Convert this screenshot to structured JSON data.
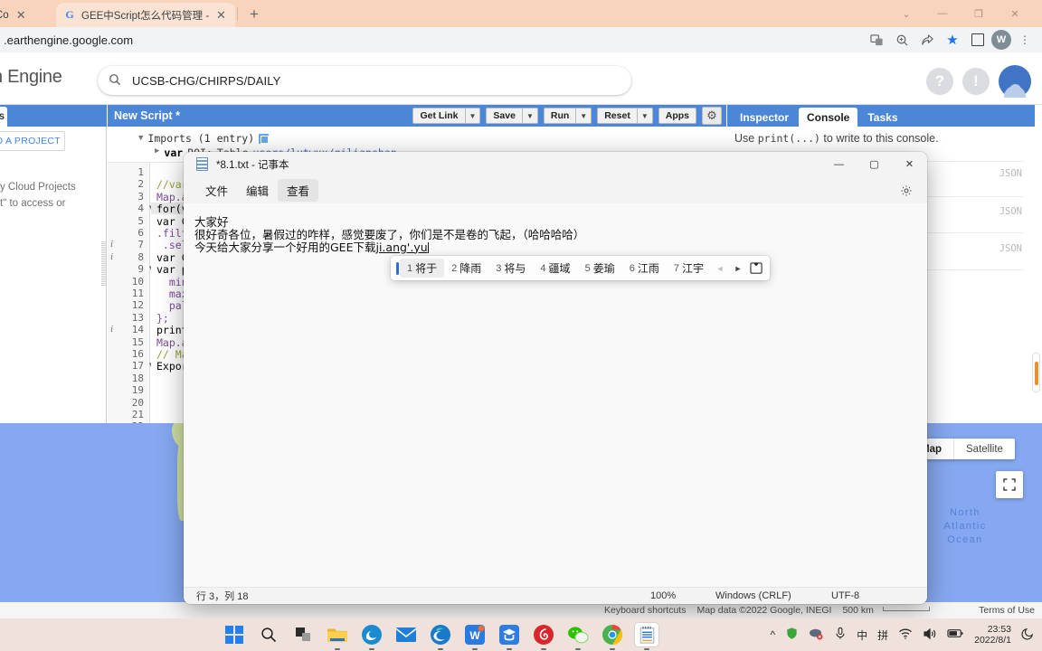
{
  "browser": {
    "tabs": [
      {
        "title": "gine Co",
        "favicon": "none",
        "active": false
      },
      {
        "title": "GEE中Script怎么代码管理 - Goo",
        "favicon": "google-g",
        "active": true
      }
    ],
    "new_tab_label": "+",
    "window_controls": [
      "chevron-down",
      "minimize",
      "maximize",
      "close"
    ],
    "address": ".earthengine.google.com",
    "toolbar_icons": [
      "translate-icon",
      "zoom-icon",
      "share-icon",
      "bookmark-star-icon",
      "sidepanel-icon",
      "profile-avatar",
      "menu-dots-icon"
    ],
    "profile_initial": "W"
  },
  "gee": {
    "logo": "h Engine",
    "search": {
      "value": "UCSB-CHG/CHIRPS/DAILY",
      "icon": "search-icon"
    },
    "help_icon": "help-icon",
    "notification_icon": "alert-icon"
  },
  "left_panel": {
    "tab_label": "ts",
    "new_project_button": "O A PROJECT",
    "body_text_line1": "y Cloud Projects",
    "body_text_line2": "t\" to access or"
  },
  "editor": {
    "script_title": "New Script *",
    "buttons": [
      {
        "label": "Get Link",
        "has_dropdown": true
      },
      {
        "label": "Save",
        "has_dropdown": true
      },
      {
        "label": "Run",
        "has_dropdown": true
      },
      {
        "label": "Reset",
        "has_dropdown": true
      },
      {
        "label": "Apps",
        "has_dropdown": false
      }
    ],
    "settings_icon": "gear-icon",
    "imports": {
      "header": "Imports (1 entry)",
      "entry_keyword": "var",
      "entry_name": "ROI:",
      "entry_type": "Table",
      "entry_path": "users/lutwxx/qilianshan"
    },
    "lines": [
      {
        "n": 1,
        "fold": false,
        "info": false,
        "text": ""
      },
      {
        "n": 2,
        "fold": false,
        "info": false,
        "text": "//var"
      },
      {
        "n": 3,
        "fold": false,
        "info": false,
        "text": "Map.a"
      },
      {
        "n": 4,
        "fold": true,
        "info": false,
        "text": "for(v"
      },
      {
        "n": 5,
        "fold": false,
        "info": false,
        "text": "var C"
      },
      {
        "n": 6,
        "fold": false,
        "info": false,
        "text": ".filt"
      },
      {
        "n": 7,
        "fold": false,
        "info": true,
        "text": " .sel"
      },
      {
        "n": 8,
        "fold": false,
        "info": true,
        "text": "var C"
      },
      {
        "n": 9,
        "fold": true,
        "info": false,
        "text": "var p"
      },
      {
        "n": 10,
        "fold": false,
        "info": false,
        "text": "  min"
      },
      {
        "n": 11,
        "fold": false,
        "info": false,
        "text": "  max"
      },
      {
        "n": 12,
        "fold": false,
        "info": false,
        "text": "  pal"
      },
      {
        "n": 13,
        "fold": false,
        "info": false,
        "text": "};"
      },
      {
        "n": 14,
        "fold": false,
        "info": true,
        "text": "print"
      },
      {
        "n": 15,
        "fold": false,
        "info": false,
        "text": "Map.a"
      },
      {
        "n": 16,
        "fold": false,
        "info": false,
        "text": "// Ma"
      },
      {
        "n": 17,
        "fold": true,
        "info": false,
        "text": "Expor"
      },
      {
        "n": 18,
        "fold": false,
        "info": false,
        "text": ""
      },
      {
        "n": 19,
        "fold": false,
        "info": false,
        "text": ""
      },
      {
        "n": 20,
        "fold": false,
        "info": false,
        "text": ""
      },
      {
        "n": 21,
        "fold": false,
        "info": false,
        "text": ""
      },
      {
        "n": 22,
        "fold": false,
        "info": false,
        "text": ""
      }
    ]
  },
  "console": {
    "tabs": [
      {
        "label": "Inspector",
        "active": false
      },
      {
        "label": "Console",
        "active": true
      },
      {
        "label": "Tasks",
        "active": false
      }
    ],
    "hint_pre": "Use ",
    "hint_code": "print(...)",
    "hint_post": " to write to this console.",
    "json_labels": [
      "JSON",
      "JSON",
      "JSON"
    ]
  },
  "map": {
    "type_buttons": [
      {
        "label": "Map",
        "selected": true
      },
      {
        "label": "Satellite",
        "selected": false
      }
    ],
    "fullscreen_icon": "fullscreen-icon",
    "ocean_label": "North\nAtlantic\nOcean",
    "footer": {
      "keyboard_shortcuts": "Keyboard shortcuts",
      "attribution": "Map data ©2022 Google, INEGI",
      "scale": "500 km",
      "terms": "Terms of Use"
    }
  },
  "notepad": {
    "title": "*8.1.txt - 记事本",
    "icon": "notepad-icon",
    "window_controls": [
      "minimize",
      "maximize",
      "close"
    ],
    "menus": [
      {
        "label": "文件",
        "highlight": false
      },
      {
        "label": "编辑",
        "highlight": false
      },
      {
        "label": "查看",
        "highlight": true
      }
    ],
    "settings_icon": "gear-icon",
    "content_line1": "大家好",
    "content_line2": "很好奇各位，暑假过的咋样，感觉要废了，你们是不是卷的飞起，（哈哈哈哈）",
    "content_line3_pre": "今天给大家分享一个好用的GEE下载",
    "content_line3_composing": "ji.ang'.yu",
    "status": {
      "position": "行 3，列 18",
      "zoom": "100%",
      "line_ending": "Windows (CRLF)",
      "encoding": "UTF-8"
    }
  },
  "ime": {
    "candidates": [
      {
        "index": "1",
        "text": "将于",
        "selected": true
      },
      {
        "index": "2",
        "text": "降雨",
        "selected": false
      },
      {
        "index": "3",
        "text": "将与",
        "selected": false
      },
      {
        "index": "4",
        "text": "疆域",
        "selected": false
      },
      {
        "index": "5",
        "text": "姜瑜",
        "selected": false
      },
      {
        "index": "6",
        "text": "江雨",
        "selected": false
      },
      {
        "index": "7",
        "text": "江宇",
        "selected": false
      }
    ],
    "prev_arrow": "◄",
    "next_arrow": "►",
    "logo_icon": "ime-logo-icon"
  },
  "taskbar": {
    "items": [
      {
        "name": "start-button",
        "running": false
      },
      {
        "name": "search-button",
        "running": false
      },
      {
        "name": "task-view-button",
        "running": false
      },
      {
        "name": "file-explorer",
        "running": true
      },
      {
        "name": "edge-legacy",
        "running": true
      },
      {
        "name": "mail",
        "running": false
      },
      {
        "name": "edge",
        "running": true
      },
      {
        "name": "wps-office",
        "running": true
      },
      {
        "name": "xuexi-app",
        "running": true
      },
      {
        "name": "netease-music",
        "running": true
      },
      {
        "name": "wechat",
        "running": true
      },
      {
        "name": "chrome",
        "running": true
      },
      {
        "name": "notepad",
        "running": true
      }
    ],
    "tray": {
      "chevron": "^",
      "icons": [
        "green-shield-icon",
        "cloud-error-icon",
        "mic-icon"
      ],
      "ime_mode": "中",
      "ime_pinyin": "拼",
      "network_icon": "wifi-icon",
      "volume_icon": "volume-icon",
      "battery_icon": "battery-icon",
      "time": "23:53",
      "date": "2022/8/1",
      "notification_icon": "moon-icon"
    }
  },
  "colors": {
    "gee_blue": "#4b87d6",
    "chrome_tab_bg": "#f8d4bd",
    "ocean": "#85a8f0",
    "accent_orange": "#e8912a"
  }
}
